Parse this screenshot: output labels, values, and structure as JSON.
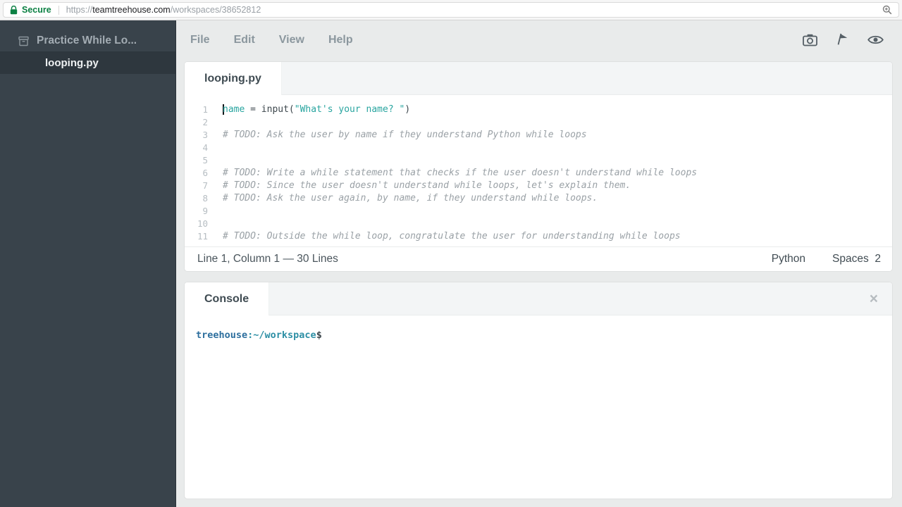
{
  "browser": {
    "secure_label": "Secure",
    "url_scheme": "https://",
    "url_host": "teamtreehouse.com",
    "url_path": "/workspaces/38652812"
  },
  "colors": {
    "secure_green": "#0b8043",
    "sidebar_bg": "#39434b",
    "teal_token": "#29a5a0",
    "comment_gray": "#9aa1a6"
  },
  "sidebar": {
    "project_name": "Practice While Lo...",
    "files": [
      {
        "name": "looping.py"
      }
    ]
  },
  "menubar": {
    "items": [
      {
        "label": "File"
      },
      {
        "label": "Edit"
      },
      {
        "label": "View"
      },
      {
        "label": "Help"
      }
    ],
    "icons": [
      "camera-icon",
      "flag-icon",
      "eye-icon"
    ]
  },
  "editor": {
    "tab": "looping.py",
    "lines": [
      {
        "n": 1,
        "cursor": true,
        "parts": [
          [
            "name",
            "name"
          ],
          [
            "plain",
            " = input("
          ],
          [
            "string",
            "\"What's your name? \""
          ],
          [
            "plain",
            ")"
          ]
        ]
      },
      {
        "n": 2,
        "parts": []
      },
      {
        "n": 3,
        "parts": [
          [
            "comment",
            "# TODO: Ask the user by name if they understand Python while loops"
          ]
        ]
      },
      {
        "n": 4,
        "parts": []
      },
      {
        "n": 5,
        "parts": []
      },
      {
        "n": 6,
        "parts": [
          [
            "comment",
            "# TODO: Write a while statement that checks if the user doesn't understand while loops"
          ]
        ]
      },
      {
        "n": 7,
        "parts": [
          [
            "comment",
            "# TODO: Since the user doesn't understand while loops, let's explain them."
          ]
        ]
      },
      {
        "n": 8,
        "parts": [
          [
            "comment",
            "# TODO: Ask the user again, by name, if they understand while loops."
          ]
        ]
      },
      {
        "n": 9,
        "parts": []
      },
      {
        "n": 10,
        "parts": []
      },
      {
        "n": 11,
        "parts": [
          [
            "comment",
            "# TODO: Outside the while loop, congratulate the user for understanding while loops"
          ]
        ]
      }
    ],
    "status": {
      "left": "Line 1, Column 1 — 30 Lines",
      "language": "Python",
      "spaces_label": "Spaces",
      "spaces_value": "2"
    }
  },
  "console": {
    "tab": "Console",
    "close_glyph": "×",
    "prompt_user": "treehouse",
    "prompt_path": ":~/workspace",
    "prompt_symbol": "$"
  }
}
